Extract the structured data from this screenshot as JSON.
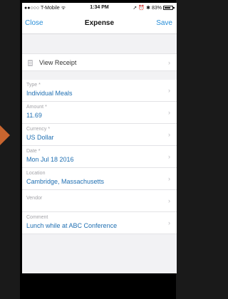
{
  "status_bar": {
    "carrier": "●●○○○ T-Mobile ",
    "wifi": "ᯤ",
    "time": "1:34 PM",
    "battery": "83%",
    "battery_level": 0.83
  },
  "nav": {
    "close": "Close",
    "title": "Expense",
    "save": "Save"
  },
  "receipt": {
    "label": "View Receipt",
    "icon": "receipt-icon"
  },
  "fields": [
    {
      "label": "Type *",
      "value": "Individual Meals"
    },
    {
      "label": "Amount *",
      "value": "11.69"
    },
    {
      "label": "Currency *",
      "value": "US Dollar"
    },
    {
      "label": "Date *",
      "value": "Mon Jul 18 2016"
    },
    {
      "label": "Location",
      "value": "Cambridge, Massachusetts"
    },
    {
      "label": "Vendor",
      "value": ""
    },
    {
      "label": "Comment",
      "value": "Lunch while at ABC Conference"
    }
  ],
  "chevron": "›",
  "colors": {
    "accent": "#2a8fd8",
    "value_text": "#1f6fb2",
    "label_text": "#a3a3a8",
    "background": "#f2f2f4",
    "pointer": "#c8652f"
  }
}
